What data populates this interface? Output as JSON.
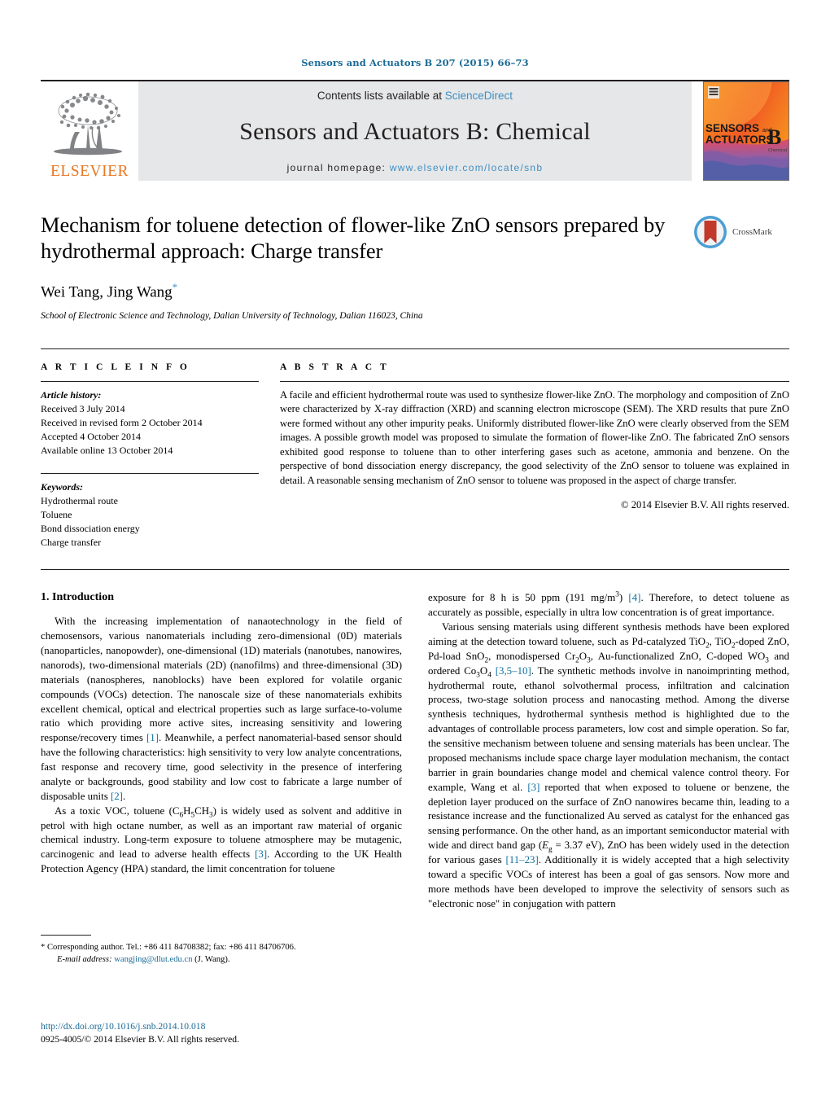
{
  "running_head": "Sensors and Actuators B 207 (2015) 66–73",
  "masthead": {
    "publisher_logo_name": "elsevier-tree-logo",
    "publisher_wordmark": "ELSEVIER",
    "contents_prefix": "Contents lists available at",
    "contents_link": "ScienceDirect",
    "journal_title": "Sensors and Actuators B: Chemical",
    "homepage_prefix": "journal homepage:",
    "homepage_url": "www.elsevier.com/locate/snb",
    "cover": {
      "line1": "SENSORS",
      "and": "and",
      "line2": "ACTUATORS",
      "letter": "B",
      "sub": "Chemical"
    }
  },
  "article": {
    "title": "Mechanism for toluene detection of flower-like ZnO sensors prepared by hydrothermal approach: Charge transfer",
    "authors": "Wei Tang, Jing Wang",
    "author_star": "*",
    "affiliation": "School of Electronic Science and Technology, Dalian University of Technology, Dalian 116023, China",
    "crossmark_label": "CrossMark"
  },
  "article_info": {
    "heading": "A R T I C L E   I N F O",
    "history_label": "Article history:",
    "history": [
      "Received 3 July 2014",
      "Received in revised form 2 October 2014",
      "Accepted 4 October 2014",
      "Available online 13 October 2014"
    ],
    "keywords_label": "Keywords:",
    "keywords": [
      "Hydrothermal route",
      "Toluene",
      "Bond dissociation energy",
      "Charge transfer"
    ]
  },
  "abstract": {
    "heading": "A B S T R A C T",
    "text": "A facile and efficient hydrothermal route was used to synthesize flower-like ZnO. The morphology and composition of ZnO were characterized by X-ray diffraction (XRD) and scanning electron microscope (SEM). The XRD results that pure ZnO were formed without any other impurity peaks. Uniformly distributed flower-like ZnO were clearly observed from the SEM images. A possible growth model was proposed to simulate the formation of flower-like ZnO. The fabricated ZnO sensors exhibited good response to toluene than to other interfering gases such as acetone, ammonia and benzene. On the perspective of bond dissociation energy discrepancy, the good selectivity of the ZnO sensor to toluene was explained in detail. A reasonable sensing mechanism of ZnO sensor to toluene was proposed in the aspect of charge transfer.",
    "copyright": "© 2014 Elsevier B.V. All rights reserved."
  },
  "introduction": {
    "heading": "1.  Introduction",
    "left_paragraphs": [
      "With the increasing implementation of nanaotechnology in the field of chemosensors, various nanomaterials including zero-dimensional (0D) materials (nanoparticles, nanopowder), one-dimensional (1D) materials (nanotubes, nanowires, nanorods), two-dimensional materials (2D) (nanofilms) and three-dimensional (3D) materials (nanospheres, nanoblocks) have been explored for volatile organic compounds (VOCs) detection. The nanoscale size of these nanomaterials exhibits excellent chemical, optical and electrical properties such as large surface-to-volume ratio which providing more active sites, increasing sensitivity and lowering response/recovery times [1]. Meanwhile, a perfect nanomaterial-based sensor should have the following characteristics: high sensitivity to very low analyte concentrations, fast response and recovery time, good selectivity in the presence of interfering analyte or backgrounds, good stability and low cost to fabricate a large number of disposable units [2].",
      "As a toxic VOC, toluene (C6H5CH3) is widely used as solvent and additive in petrol with high octane number, as well as an important raw material of organic chemical industry. Long-term exposure to toluene atmosphere may be mutagenic, carcinogenic and lead to adverse health effects [3]. According to the UK Health Protection Agency (HPA) standard, the limit concentration for toluene"
    ],
    "right_paragraphs": [
      "exposure for 8 h is 50 ppm (191 mg/m3) [4]. Therefore, to detect toluene as accurately as possible, especially in ultra low concentration is of great importance.",
      "Various sensing materials using different synthesis methods have been explored aiming at the detection toward toluene, such as Pd-catalyzed TiO2, TiO2-doped ZnO, Pd-load SnO2, monodispersed Cr2O3, Au-functionalized ZnO, C-doped WO3 and ordered Co3O4 [3,5–10]. The synthetic methods involve in nanoimprinting method, hydrothermal route, ethanol solvothermal process, infiltration and calcination process, two-stage solution process and nanocasting method. Among the diverse synthesis techniques, hydrothermal synthesis method is highlighted due to the advantages of controllable process parameters, low cost and simple operation. So far, the sensitive mechanism between toluene and sensing materials has been unclear. The proposed mechanisms include space charge layer modulation mechanism, the contact barrier in grain boundaries change model and chemical valence control theory. For example, Wang et al. [3] reported that when exposed to toluene or benzene, the depletion layer produced on the surface of ZnO nanowires became thin, leading to a resistance increase and the functionalized Au served as catalyst for the enhanced gas sensing performance. On the other hand, as an important semiconductor material with wide and direct band gap (Eg = 3.37 eV), ZnO has been widely used in the detection for various gases [11–23]. Additionally it is widely accepted that a high selectivity toward a specific VOCs of interest has been a goal of gas sensors. Now more and more methods have been developed to improve the selectivity of sensors such as \"electronic nose\" in conjugation with pattern"
    ]
  },
  "footnote": {
    "star": "*",
    "corresponding": "Corresponding author. Tel.: +86 411 84708382; fax: +86 411 84706706.",
    "email_label": "E-mail address:",
    "email": "wangjing@dlut.edu.cn",
    "email_suffix": "(J. Wang)."
  },
  "imprint": {
    "doi": "http://dx.doi.org/10.1016/j.snb.2014.10.018",
    "issn_line": "0925-4005/© 2014 Elsevier B.V. All rights reserved."
  },
  "colors": {
    "link_blue": "#1a6a96",
    "ref_blue": "#0f6ea0",
    "elsevier_orange": "#E87722",
    "masthead_grey": "#e6e7e8"
  }
}
